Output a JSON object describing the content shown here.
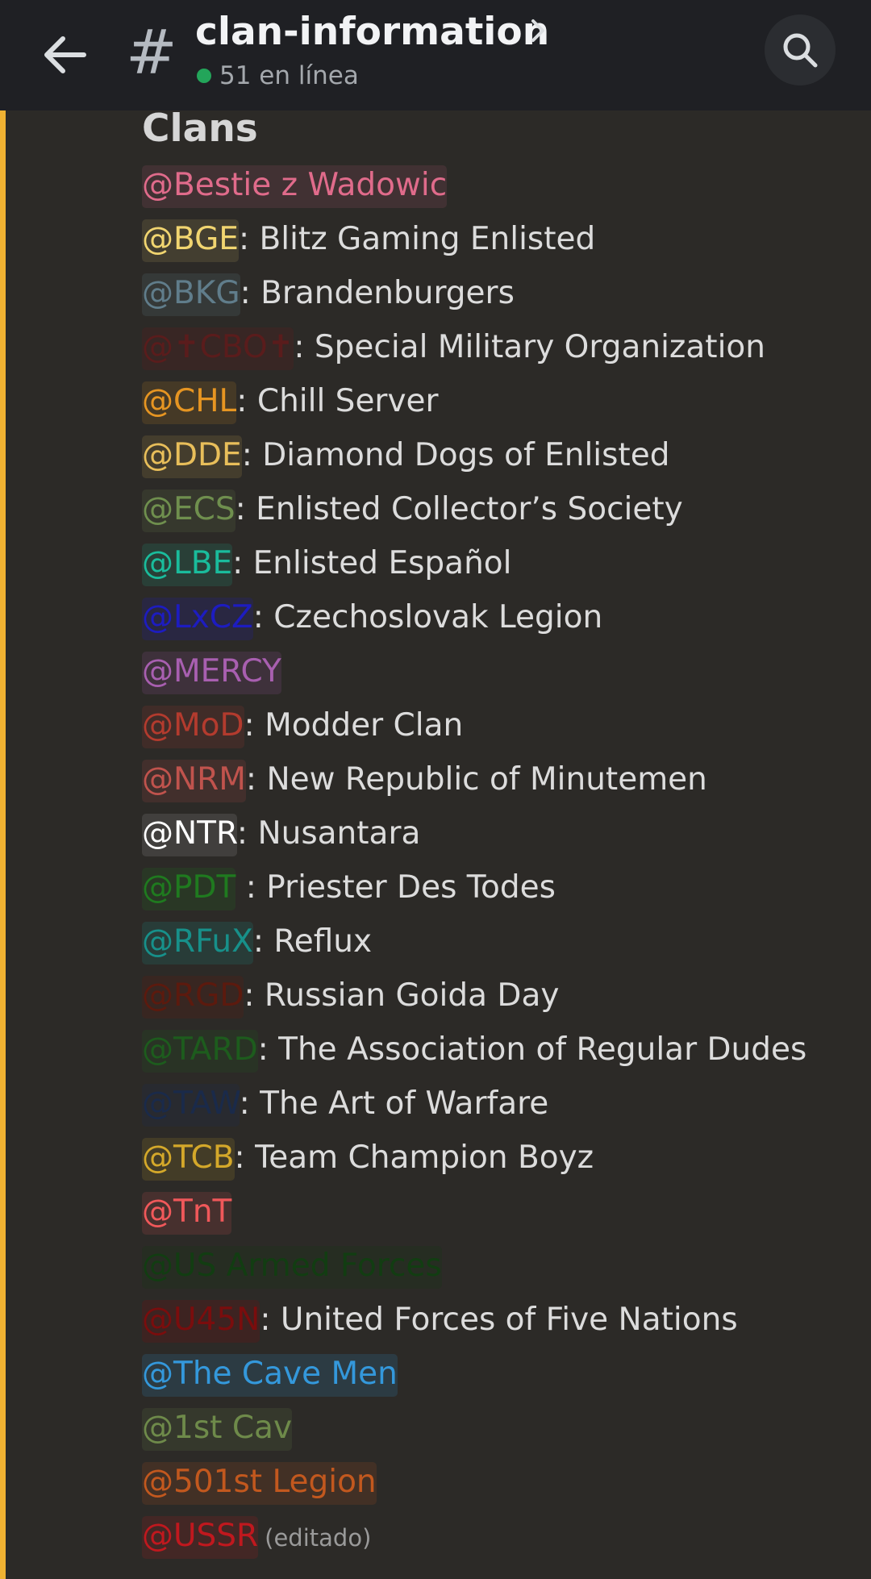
{
  "header": {
    "channel_name": "clan-information",
    "channel_icon": "hash-icon",
    "online_status": "51 en línea"
  },
  "heading": "Clans",
  "rows": [
    {
      "tag": "@Bestie z Wadowic",
      "desc": "",
      "color": "#e06b8b",
      "bg": "rgba(224,107,139,0.12)"
    },
    {
      "tag": "@BGE",
      "desc": ": Blitz Gaming Enlisted",
      "color": "#f1d570",
      "bg": "rgba(241,213,112,0.12)"
    },
    {
      "tag": "@BKG",
      "desc": ": Brandenburgers",
      "color": "#607d8b",
      "bg": "rgba(96,125,139,0.18)"
    },
    {
      "tag": "@✝CBO✝",
      "desc": ": Special Military Organization",
      "color": "#5a1c1c",
      "bg": "rgba(90,28,28,0.25)"
    },
    {
      "tag": "@CHL",
      "desc": ": Chill Server",
      "color": "#e69522",
      "bg": "rgba(230,149,34,0.14)"
    },
    {
      "tag": "@DDE",
      "desc": ": Diamond Dogs of Enlisted",
      "color": "#e8be5a",
      "bg": "rgba(232,190,90,0.13)"
    },
    {
      "tag": "@ECS",
      "desc": ": Enlisted Collector’s Society",
      "color": "#6f8f4e",
      "bg": "rgba(111,143,78,0.15)"
    },
    {
      "tag": "@LBE",
      "desc": ": Enlisted Español",
      "color": "#1abc9c",
      "bg": "rgba(26,188,156,0.14)"
    },
    {
      "tag": "@LxCZ",
      "desc": ": Czechoslovak Legion",
      "color": "#1d1cc0",
      "bg": "rgba(29,28,192,0.18)"
    },
    {
      "tag": "@MERCY",
      "desc": "",
      "color": "#a85fb0",
      "bg": "rgba(168,95,176,0.15)"
    },
    {
      "tag": "@MoD",
      "desc": ": Modder Clan",
      "color": "#b33b2e",
      "bg": "rgba(179,59,46,0.15)"
    },
    {
      "tag": "@NRM",
      "desc": ": New Republic of Minutemen",
      "color": "#c0534d",
      "bg": "rgba(192,83,77,0.15)"
    },
    {
      "tag": "@NTR",
      "desc": ": Nusantara",
      "color": "#ffffff",
      "bg": "rgba(255,255,255,0.10)"
    },
    {
      "tag": "@PDT",
      "desc": " : Priester Des Todes",
      "color": "#1f7a1f",
      "bg": "rgba(31,122,31,0.16)"
    },
    {
      "tag": "@RFuX",
      "desc": ": Reflux",
      "color": "#17908a",
      "bg": "rgba(23,144,138,0.18)"
    },
    {
      "tag": "@RGD",
      "desc": ": Russian Goida Day",
      "color": "#5c1a0e",
      "bg": "rgba(92,26,14,0.25)"
    },
    {
      "tag": "@TARD",
      "desc": ": The Association of Regular Dudes",
      "color": "#1d5c1d",
      "bg": "rgba(29,92,29,0.20)"
    },
    {
      "tag": "@TAW",
      "desc": ": The Art of Warfare",
      "color": "#1a2a4a",
      "bg": "rgba(26,42,74,0.25)"
    },
    {
      "tag": "@TCB",
      "desc": ": Team Champion Boyz",
      "color": "#d4a82a",
      "bg": "rgba(212,168,42,0.14)"
    },
    {
      "tag": "@TnT",
      "desc": "",
      "color": "#f0585a",
      "bg": "rgba(240,88,90,0.14)"
    },
    {
      "tag": "@US Armed Forces",
      "desc": "",
      "color": "#123d12",
      "bg": "rgba(18,61,18,0.22)"
    },
    {
      "tag": "@U45N",
      "desc": ": United Forces of Five Nations",
      "color": "#7a0d0d",
      "bg": "rgba(122,13,13,0.22)"
    },
    {
      "tag": "@The Cave Men",
      "desc": "",
      "color": "#3498db",
      "bg": "rgba(52,152,219,0.16)"
    },
    {
      "tag": "@1st Cav",
      "desc": "",
      "color": "#6e8a4a",
      "bg": "rgba(110,138,74,0.15)"
    },
    {
      "tag": "@501st Legion",
      "desc": "",
      "color": "#c2581e",
      "bg": "rgba(194,88,30,0.15)"
    },
    {
      "tag": "@USSR",
      "desc": "",
      "color": "#c0181e",
      "bg": "rgba(192,24,30,0.16)"
    }
  ],
  "edited_label": "(editado)",
  "colors": {
    "header_bg": "#1f2024",
    "content_bg": "#2c2a27",
    "accent_bar": "#f0b232",
    "online_dot": "#23a55a"
  }
}
